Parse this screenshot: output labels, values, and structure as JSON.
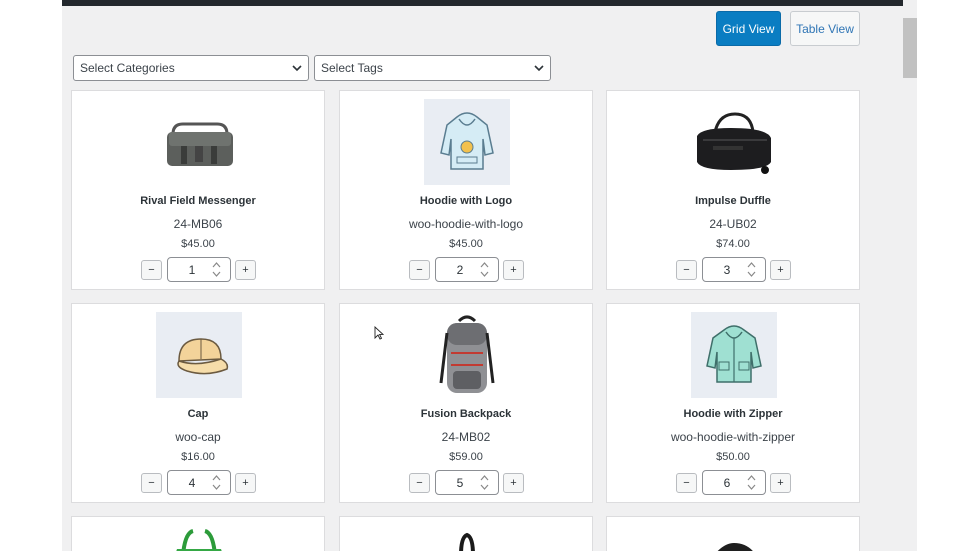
{
  "toolbar": {
    "grid_view_label": "Grid View",
    "table_view_label": "Table View"
  },
  "filters": {
    "categories_placeholder": "Select Categories",
    "tags_placeholder": "Select Tags"
  },
  "products": [
    {
      "name": "Rival Field Messenger",
      "sku": "24-MB06",
      "price": "$45.00",
      "qty": "1",
      "image_icon": "messenger-bag-icon"
    },
    {
      "name": "Hoodie with Logo",
      "sku": "woo-hoodie-with-logo",
      "price": "$45.00",
      "qty": "2",
      "image_icon": "hoodie-logo-icon"
    },
    {
      "name": "Impulse Duffle",
      "sku": "24-UB02",
      "price": "$74.00",
      "qty": "3",
      "image_icon": "duffle-bag-icon"
    },
    {
      "name": "Cap",
      "sku": "woo-cap",
      "price": "$16.00",
      "qty": "4",
      "image_icon": "cap-icon"
    },
    {
      "name": "Fusion Backpack",
      "sku": "24-MB02",
      "price": "$59.00",
      "qty": "5",
      "image_icon": "backpack-icon"
    },
    {
      "name": "Hoodie with Zipper",
      "sku": "woo-hoodie-with-zipper",
      "price": "$50.00",
      "qty": "6",
      "image_icon": "hoodie-zipper-icon"
    }
  ],
  "controls": {
    "minus": "−",
    "plus": "+"
  },
  "colors": {
    "accent": "#0a7dc2",
    "card_bg": "#ffffff",
    "page_bg": "#f0f0f1"
  }
}
